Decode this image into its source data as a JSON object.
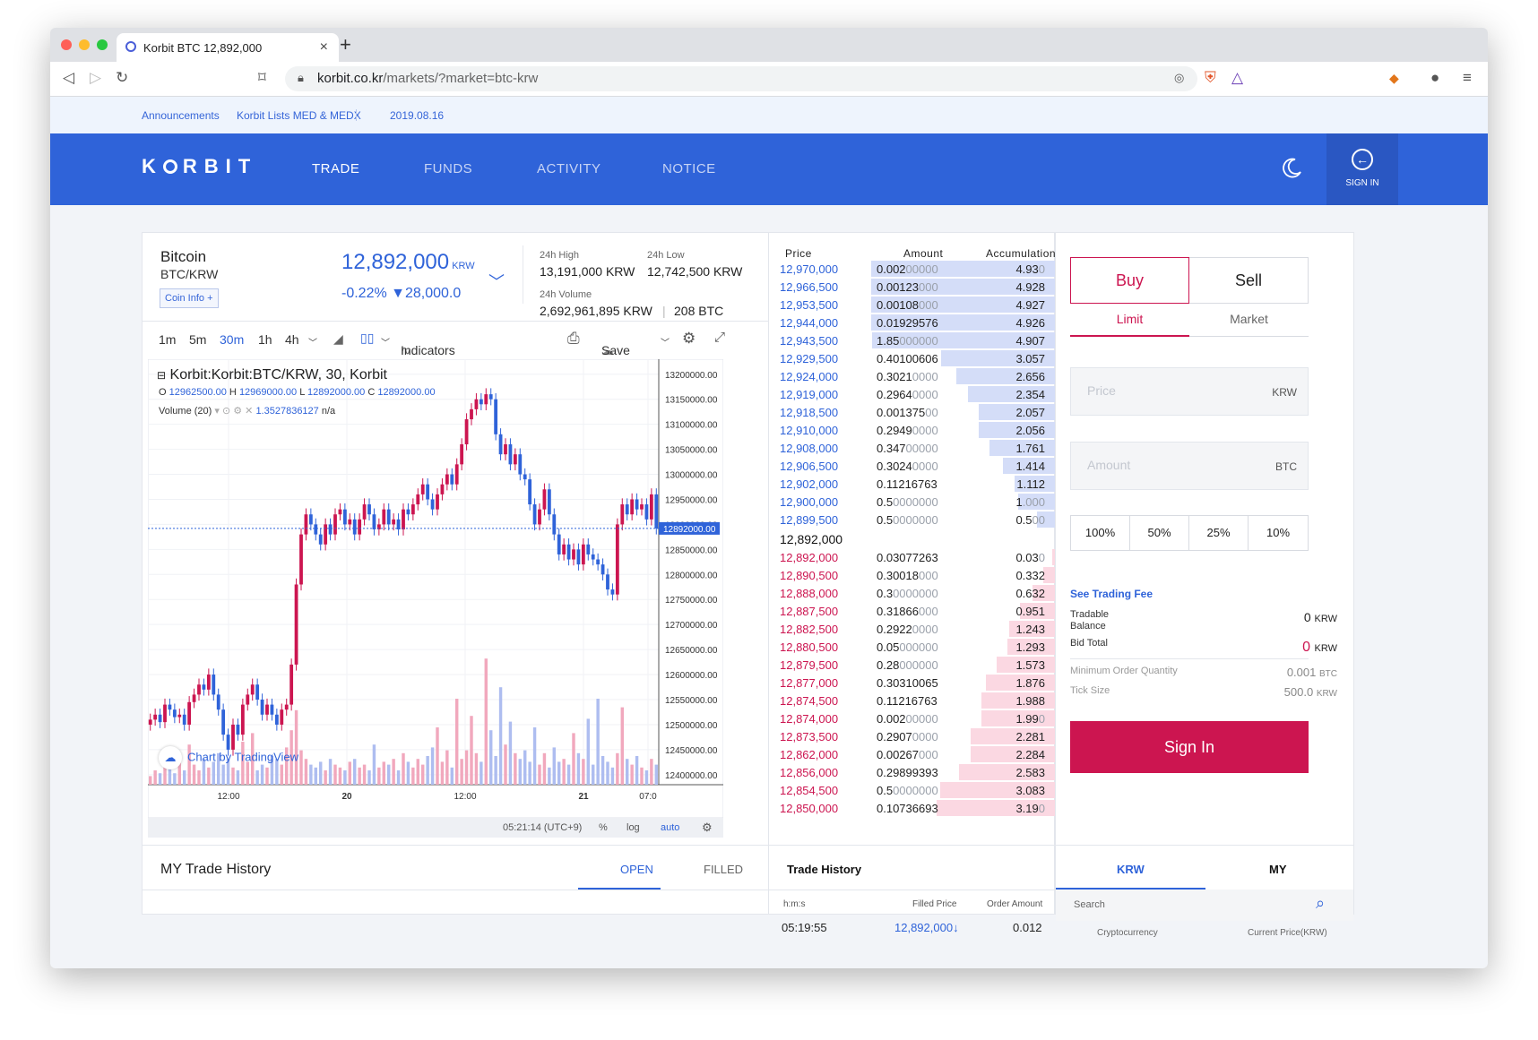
{
  "browser": {
    "tab_title": "Korbit BTC 12,892,000",
    "url_host": "korbit.co.kr",
    "url_path": "/markets/?market=btc-krw"
  },
  "announcement": {
    "label": "Announcements",
    "title": "Korbit Lists MED & MEDX",
    "date": "2019.08.16"
  },
  "nav": {
    "logo_left": "K",
    "logo_right": "RBIT",
    "links": [
      "TRADE",
      "FUNDS",
      "ACTIVITY",
      "NOTICE"
    ],
    "sign_in": "SIGN IN"
  },
  "coin": {
    "name": "Bitcoin",
    "pair": "BTC/KRW",
    "info_button": "Coin Info +",
    "price": "12,892,000",
    "price_unit": "KRW",
    "change": "-0.22% ▼28,000.0",
    "high_label": "24h High",
    "high_value": "13,191,000 KRW",
    "low_label": "24h Low",
    "low_value": "12,742,500 KRW",
    "volume_label": "24h Volume",
    "volume_krw": "2,692,961,895 KRW",
    "volume_btc": "208 BTC"
  },
  "chart_toolbar": {
    "intervals": [
      "1m",
      "5m",
      "30m",
      "1h",
      "4h"
    ],
    "active_interval": "30m",
    "indicators": "Indicators",
    "save": "Save"
  },
  "chart_data": {
    "type": "candlestick",
    "title": "Korbit:Korbit:BTC/KRW, 30, Korbit",
    "ohlc_line": {
      "o_label": "O",
      "o": "12962500.00",
      "h_label": "H",
      "h": "12969000.00",
      "l_label": "L",
      "l": "12892000.00",
      "c_label": "C",
      "c": "12892000.00"
    },
    "volume_label": "Volume (20)",
    "volume_value": "1.3527836127",
    "volume_na": "n/a",
    "ylim": [
      12380000,
      13230000
    ],
    "y_ticks": [
      "13200000.00",
      "13150000.00",
      "13100000.00",
      "13050000.00",
      "13000000.00",
      "12950000.00",
      "12900000.00",
      "12850000.00",
      "12800000.00",
      "12750000.00",
      "12700000.00",
      "12650000.00",
      "12600000.00",
      "12550000.00",
      "12500000.00",
      "12450000.00",
      "12400000.00"
    ],
    "x_ticks": [
      "12:00",
      "20",
      "12:00",
      "21",
      "07:0"
    ],
    "last_price": 12892000,
    "last_price_label": "12892000.00",
    "closes": [
      12510000,
      12520000,
      12505000,
      12540000,
      12530000,
      12515000,
      12520000,
      12500000,
      12545000,
      12560000,
      12580000,
      12570000,
      12600000,
      12560000,
      12530000,
      12480000,
      12450000,
      12500000,
      12480000,
      12540000,
      12560000,
      12580000,
      12550000,
      12520000,
      12540000,
      12520000,
      12500000,
      12530000,
      12540000,
      12620000,
      12780000,
      12880000,
      12920000,
      12900000,
      12880000,
      12860000,
      12900000,
      12880000,
      12920000,
      12930000,
      12900000,
      12910000,
      12880000,
      12910000,
      12940000,
      12920000,
      12890000,
      12900000,
      12930000,
      12900000,
      12910000,
      12890000,
      12930000,
      12920000,
      12940000,
      12960000,
      12980000,
      12950000,
      12930000,
      12960000,
      12980000,
      13000000,
      12980000,
      13020000,
      13060000,
      13110000,
      13130000,
      13150000,
      13140000,
      13160000,
      13150000,
      13080000,
      13040000,
      13060000,
      13020000,
      13040000,
      13000000,
      12990000,
      12940000,
      12900000,
      12930000,
      12970000,
      12920000,
      12880000,
      12840000,
      12860000,
      12830000,
      12850000,
      12820000,
      12860000,
      12840000,
      12830000,
      12820000,
      12800000,
      12770000,
      12760000,
      12900000,
      12940000,
      12920000,
      12950000,
      12930000,
      12940000,
      12910000,
      12960000,
      12892000
    ],
    "volume_axis_top": 5,
    "volumes": [
      0.3,
      0.5,
      0.4,
      1.2,
      0.6,
      0.4,
      0.8,
      0.5,
      1.4,
      0.7,
      0.5,
      0.9,
      0.6,
      0.8,
      1.1,
      0.7,
      0.9,
      0.6,
      0.5,
      1.5,
      0.8,
      1.8,
      0.5,
      0.7,
      0.6,
      1.0,
      0.9,
      0.7,
      1.3,
      1.9,
      2.6,
      1.2,
      0.9,
      0.7,
      0.6,
      0.8,
      0.5,
      0.9,
      0.7,
      0.6,
      0.5,
      0.8,
      0.9,
      0.6,
      0.7,
      0.5,
      1.4,
      0.6,
      0.8,
      0.7,
      0.9,
      0.5,
      1.1,
      0.8,
      0.6,
      0.9,
      0.7,
      1.0,
      1.3,
      2.0,
      0.8,
      1.2,
      0.6,
      3.0,
      0.9,
      1.2,
      2.4,
      1.1,
      0.8,
      4.4,
      1.9,
      1.0,
      3.4,
      1.4,
      2.2,
      1.1,
      0.9,
      1.2,
      0.8,
      2.0,
      0.7,
      1.1,
      0.6,
      1.3,
      0.8,
      0.9,
      0.7,
      1.8,
      1.1,
      0.9,
      2.3,
      0.7,
      3.0,
      1.0,
      0.8,
      0.6,
      1.1,
      2.7,
      0.9,
      0.7,
      1.0,
      0.6,
      0.5,
      0.9,
      0.7
    ]
  },
  "chart_foot": {
    "time": "05:21:14 (UTC+9)",
    "pct": "%",
    "log": "log",
    "auto": "auto"
  },
  "tradingview": "Chart by TradingView",
  "orderbook": {
    "headers": [
      "Price",
      "Amount",
      "Accumulation"
    ],
    "asks": [
      {
        "p": "12,970,000",
        "a": "0.002",
        "ad": "00000",
        "c": "4.93",
        "cd": "0",
        "d": 4.93
      },
      {
        "p": "12,966,500",
        "a": "0.00123",
        "ad": "000",
        "c": "4.928",
        "cd": "",
        "d": 4.928
      },
      {
        "p": "12,953,500",
        "a": "0.00108",
        "ad": "000",
        "c": "4.927",
        "cd": "",
        "d": 4.927
      },
      {
        "p": "12,944,000",
        "a": "0.01929576",
        "ad": "",
        "c": "4.926",
        "cd": "",
        "d": 4.926
      },
      {
        "p": "12,943,500",
        "a": "1.85",
        "ad": "000000",
        "c": "4.907",
        "cd": "",
        "d": 4.907
      },
      {
        "p": "12,929,500",
        "a": "0.40100606",
        "ad": "",
        "c": "3.057",
        "cd": "",
        "d": 3.057
      },
      {
        "p": "12,924,000",
        "a": "0.3021",
        "ad": "0000",
        "c": "2.656",
        "cd": "",
        "d": 2.656
      },
      {
        "p": "12,919,000",
        "a": "0.2964",
        "ad": "0000",
        "c": "2.354",
        "cd": "",
        "d": 2.354
      },
      {
        "p": "12,918,500",
        "a": "0.001375",
        "ad": "00",
        "c": "2.057",
        "cd": "",
        "d": 2.057
      },
      {
        "p": "12,910,000",
        "a": "0.2949",
        "ad": "0000",
        "c": "2.056",
        "cd": "",
        "d": 2.056
      },
      {
        "p": "12,908,000",
        "a": "0.347",
        "ad": "00000",
        "c": "1.761",
        "cd": "",
        "d": 1.761
      },
      {
        "p": "12,906,500",
        "a": "0.3024",
        "ad": "0000",
        "c": "1.414",
        "cd": "",
        "d": 1.414
      },
      {
        "p": "12,902,000",
        "a": "0.11216763",
        "ad": "",
        "c": "1.112",
        "cd": "",
        "d": 1.112
      },
      {
        "p": "12,900,000",
        "a": "0.5",
        "ad": "0000000",
        "c": "1",
        "cd": ".000",
        "d": 1.0
      },
      {
        "p": "12,899,500",
        "a": "0.5",
        "ad": "0000000",
        "c": "0.5",
        "cd": "00",
        "d": 0.5
      }
    ],
    "mid_price": "12,892,000",
    "bids": [
      {
        "p": "12,892,000",
        "a": "0.03077263",
        "ad": "",
        "c": "0.03",
        "cd": "0",
        "d": 0.03
      },
      {
        "p": "12,890,500",
        "a": "0.30018",
        "ad": "000",
        "c": "0.332",
        "cd": "",
        "d": 0.332
      },
      {
        "p": "12,888,000",
        "a": "0.3",
        "ad": "0000000",
        "c": "0.632",
        "cd": "",
        "d": 0.632
      },
      {
        "p": "12,887,500",
        "a": "0.31866",
        "ad": "000",
        "c": "0.951",
        "cd": "",
        "d": 0.951
      },
      {
        "p": "12,882,500",
        "a": "0.2922",
        "ad": "0000",
        "c": "1.243",
        "cd": "",
        "d": 1.243
      },
      {
        "p": "12,880,500",
        "a": "0.05",
        "ad": "000000",
        "c": "1.293",
        "cd": "",
        "d": 1.293
      },
      {
        "p": "12,879,500",
        "a": "0.28",
        "ad": "000000",
        "c": "1.573",
        "cd": "",
        "d": 1.573
      },
      {
        "p": "12,877,000",
        "a": "0.30310065",
        "ad": "",
        "c": "1.876",
        "cd": "",
        "d": 1.876
      },
      {
        "p": "12,874,500",
        "a": "0.11216763",
        "ad": "",
        "c": "1.988",
        "cd": "",
        "d": 1.988
      },
      {
        "p": "12,874,000",
        "a": "0.002",
        "ad": "00000",
        "c": "1.99",
        "cd": "0",
        "d": 1.99
      },
      {
        "p": "12,873,500",
        "a": "0.2907",
        "ad": "0000",
        "c": "2.281",
        "cd": "",
        "d": 2.281
      },
      {
        "p": "12,862,000",
        "a": "0.00267",
        "ad": "000",
        "c": "2.284",
        "cd": "",
        "d": 2.284
      },
      {
        "p": "12,856,000",
        "a": "0.29899393",
        "ad": "",
        "c": "2.583",
        "cd": "",
        "d": 2.583
      },
      {
        "p": "12,854,500",
        "a": "0.5",
        "ad": "0000000",
        "c": "3.083",
        "cd": "",
        "d": 3.083
      },
      {
        "p": "12,850,000",
        "a": "0.10736693",
        "ad": "",
        "c": "3.19",
        "cd": "0",
        "d": 3.19
      }
    ]
  },
  "order": {
    "buy": "Buy",
    "sell": "Sell",
    "limit": "Limit",
    "market": "Market",
    "price_placeholder": "Price",
    "price_unit": "KRW",
    "amount_placeholder": "Amount",
    "amount_unit": "BTC",
    "pcts": [
      "100%",
      "50%",
      "25%",
      "10%"
    ],
    "trading_fee": "See Trading Fee",
    "tradable_label": "Tradable Balance",
    "tradable_value": "0",
    "tradable_unit": "KRW",
    "bid_total_label": "Bid Total",
    "bid_total_value": "0",
    "bid_total_unit": "KRW",
    "min_qty_label": "Minimum Order Quantity",
    "min_qty_value": "0.001",
    "min_qty_unit": "BTC",
    "tick_label": "Tick Size",
    "tick_value": "500.0",
    "tick_unit": "KRW",
    "sign_in": "Sign In"
  },
  "bottom": {
    "my_trade_title": "MY Trade History",
    "open": "OPEN",
    "filled": "FILLED",
    "trade_title": "Trade History",
    "col_time": "h:m:s",
    "col_price": "Filled Price",
    "col_amount": "Order Amount",
    "row_time": "05:19:55",
    "row_price": "12,892,000",
    "row_amount": "0.012",
    "krw": "KRW",
    "my": "MY",
    "search_placeholder": "Search",
    "col_crypto": "Cryptocurrency",
    "col_current": "Current Price(KRW)"
  },
  "colors": {
    "brand_blue": "#2f63d9",
    "up_red": "#cc1550",
    "down_blue": "#2f63d9",
    "ask_bar": "#d4ddf8",
    "bid_bar": "#fbd8e2"
  }
}
